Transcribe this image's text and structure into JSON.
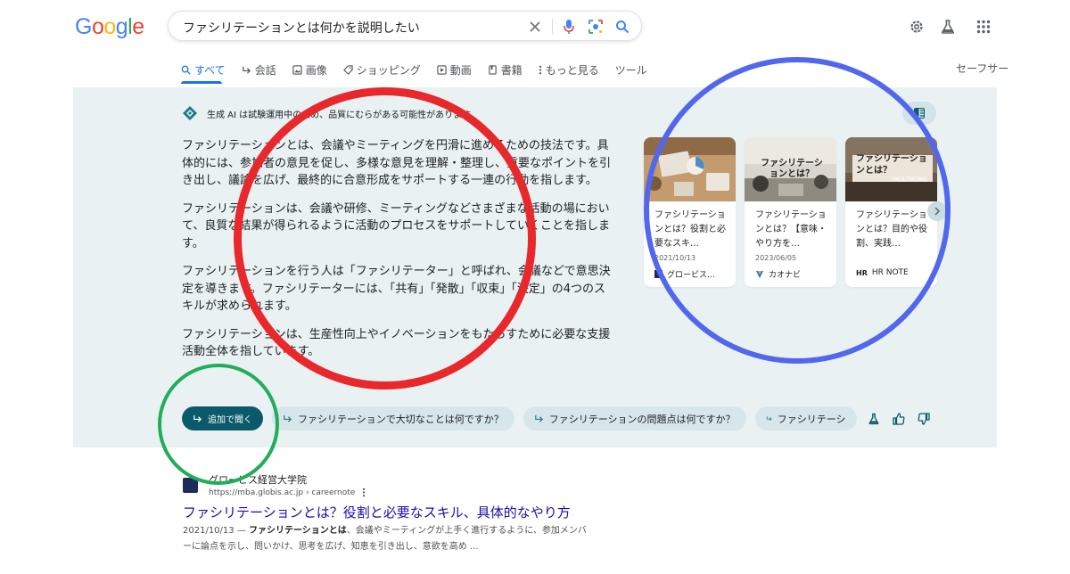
{
  "logo": {
    "text": "Google"
  },
  "search": {
    "query": "ファシリテーションとは何かを説明したい"
  },
  "tabs": [
    {
      "label": "すべて",
      "icon": "search-icon"
    },
    {
      "label": "会話",
      "icon": "arrow-icon"
    },
    {
      "label": "画像",
      "icon": "image-icon"
    },
    {
      "label": "ショッピング",
      "icon": "tag-icon"
    },
    {
      "label": "動画",
      "icon": "play-icon"
    },
    {
      "label": "書籍",
      "icon": "book-icon"
    },
    {
      "label": "もっと見る",
      "icon": "more-icon"
    },
    {
      "label": "ツール",
      "icon": ""
    }
  ],
  "safesearch": {
    "label": "セーフサー"
  },
  "ai": {
    "notice": "生成 AI は試験運用中のため、品質にむらがある可能性があります。",
    "paragraphs": [
      "ファシリテーションとは、会議やミーティングを円滑に進めるための技法です。具体的には、参加者の意見を促し、多様な意見を理解・整理し、重要なポイントを引き出し、議論を広げ、最終的に合意形成をサポートする一連の行動を指します。",
      "ファシリテーションは、会議や研修、ミーティングなどさまざまな活動の場において、良質な結果が得られるように活動のプロセスをサポートしていくことを指します。",
      "ファシリテーションを行う人は「ファシリテーター」と呼ばれ、会議などで意思決定を導きます。ファシリテーターには、「共有」「発散」「収束」「決定」の4つのスキルが求められます。",
      "ファシリテーションは、生産性向上やイノベーションをもたらすために必要な支援活動全体を指しています。"
    ],
    "cards": [
      {
        "title": "ファシリテーションとは？役割と必要なスキ…",
        "date": "2021/10/13",
        "source": "グロービス…",
        "img_text": ""
      },
      {
        "title": "ファシリテーションとは？【意味・やり方を…",
        "date": "2023/06/05",
        "source": "カオナビ",
        "img_text": "ファシリテーションとは？"
      },
      {
        "title": "ファシリテーションとは？目的や役割、実践…",
        "date": "",
        "source": "HR NOTE",
        "img_text": "ファシリテーションとは？",
        "img_sub": "FACILITATING"
      }
    ],
    "followup": "追加で聞く",
    "suggestions": [
      "ファシリテーションで大切なことは何ですか？",
      "ファシリテーションの問題点は何ですか？",
      "ファシリテーシ"
    ]
  },
  "result": {
    "site": "グロービス経営大学院",
    "url": "https://mba.globis.ac.jp › careernote",
    "title": "ファシリテーションとは？役割と必要なスキル、具体的なやり方",
    "snippet_date": "2021/10/13 — ",
    "snippet_bold": "ファシリテーションとは",
    "snippet_rest": "、会議やミーティングが上手く進行するように、参加メンバーに論点を示し、問いかけ、思考を広げ、知恵を引き出し、意欲を高め ..."
  },
  "colors": {
    "accent": "#1a73e8",
    "link": "#1a0dab",
    "ai_bg": "#e9f1f3",
    "primary_chip": "#0b5a6b",
    "ring_red": "#e8282b",
    "ring_blue": "#5167ee",
    "ring_green": "#22ad58"
  }
}
